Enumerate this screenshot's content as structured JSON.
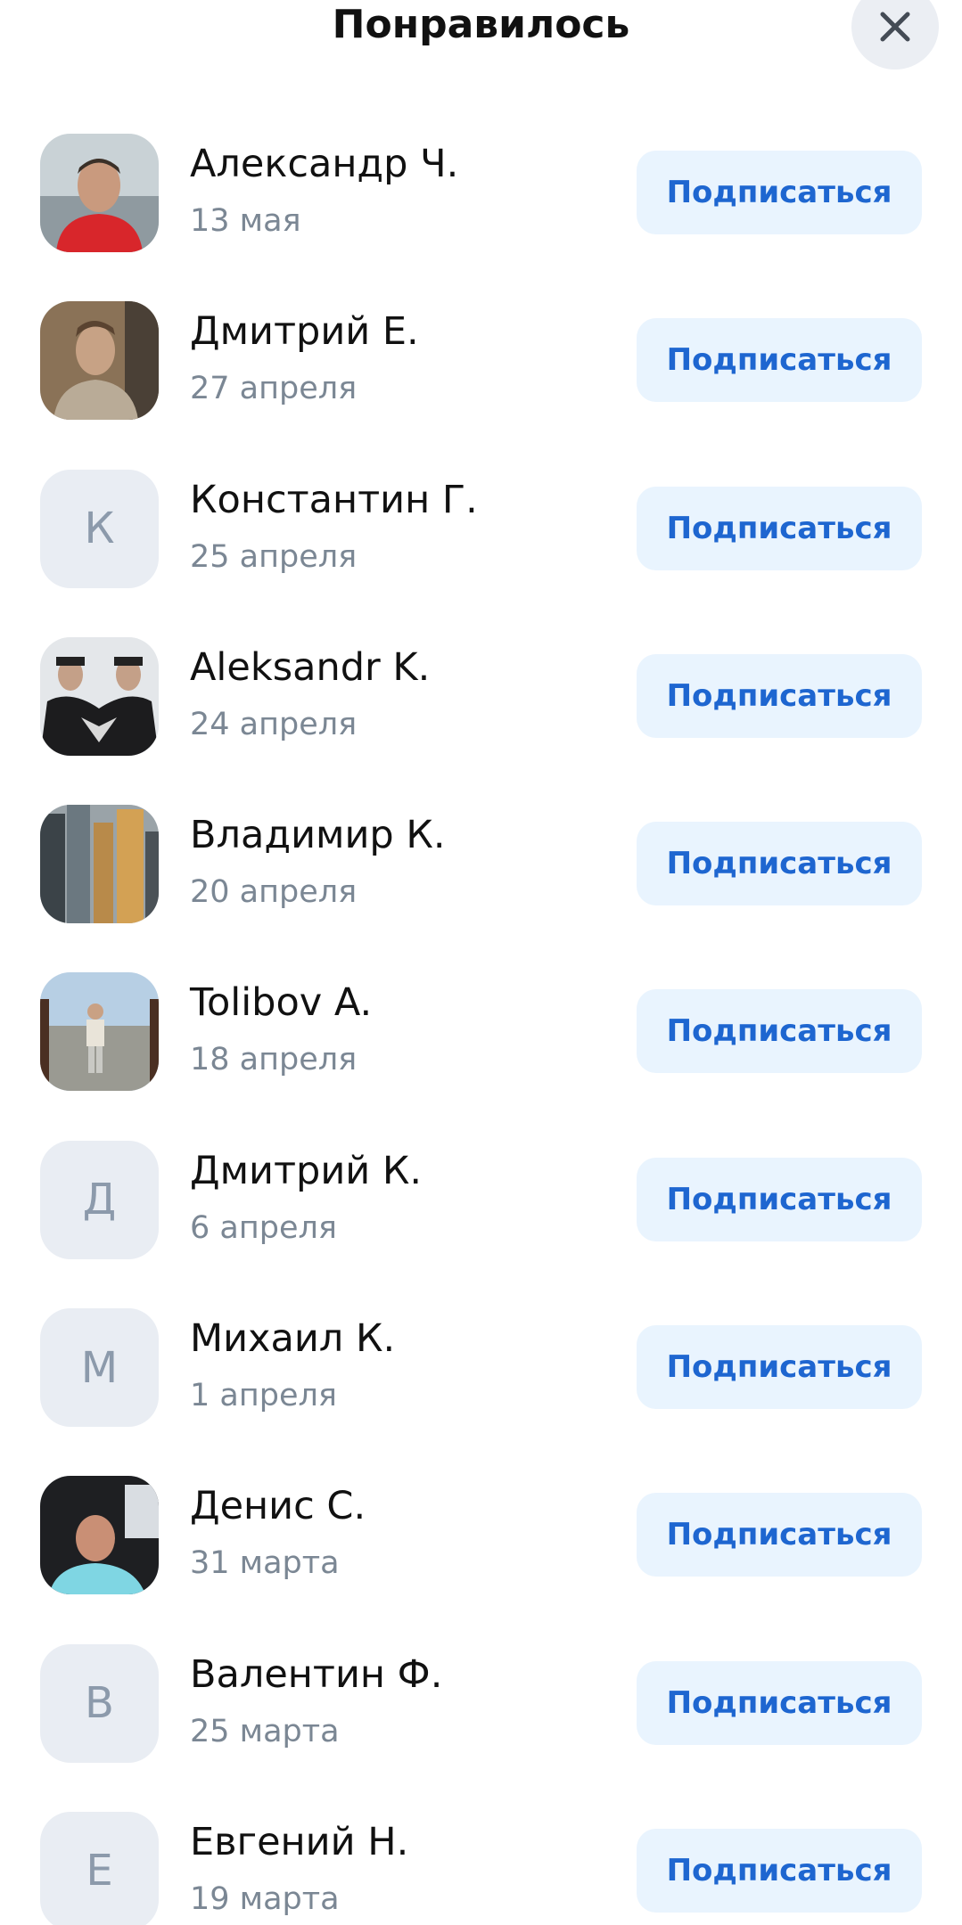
{
  "header": {
    "title": "Понравилось"
  },
  "subscribe_label": "Подписаться",
  "users": [
    {
      "name": "Александр Ч.",
      "date": "13 мая",
      "avatar_type": "photo",
      "avatar_letter": ""
    },
    {
      "name": "Дмитрий Е.",
      "date": "27 апреля",
      "avatar_type": "photo",
      "avatar_letter": ""
    },
    {
      "name": "Константин Г.",
      "date": "25 апреля",
      "avatar_type": "letter",
      "avatar_letter": "К"
    },
    {
      "name": "Aleksandr K.",
      "date": "24 апреля",
      "avatar_type": "photo",
      "avatar_letter": ""
    },
    {
      "name": "Владимир К.",
      "date": "20 апреля",
      "avatar_type": "photo",
      "avatar_letter": ""
    },
    {
      "name": "Tolibov A.",
      "date": "18 апреля",
      "avatar_type": "photo",
      "avatar_letter": ""
    },
    {
      "name": "Дмитрий К.",
      "date": "6 апреля",
      "avatar_type": "letter",
      "avatar_letter": "Д"
    },
    {
      "name": "Михаил К.",
      "date": "1 апреля",
      "avatar_type": "letter",
      "avatar_letter": "М"
    },
    {
      "name": "Денис С.",
      "date": "31 марта",
      "avatar_type": "photo",
      "avatar_letter": ""
    },
    {
      "name": "Валентин Ф.",
      "date": "25 марта",
      "avatar_type": "letter",
      "avatar_letter": "В"
    },
    {
      "name": "Евгений Н.",
      "date": "19 марта",
      "avatar_type": "letter",
      "avatar_letter": "Е"
    }
  ],
  "colors": {
    "button_bg": "#e9f4fe",
    "button_text": "#1e66d0",
    "avatar_placeholder_bg": "#e9edf3",
    "avatar_letter": "#8c9aab",
    "date_text": "#7b8794"
  }
}
